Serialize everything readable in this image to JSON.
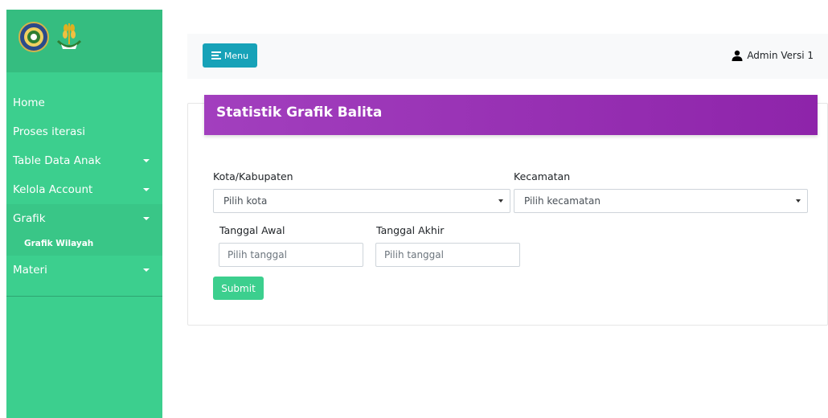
{
  "sidebar": {
    "logos": [
      "university-seal-logo",
      "wheat-emblem-logo"
    ],
    "items": [
      {
        "label": "Home",
        "has_caret": false
      },
      {
        "label": "Proses iterasi",
        "has_caret": false
      },
      {
        "label": "Table Data Anak",
        "has_caret": true
      },
      {
        "label": "Kelola Account",
        "has_caret": true
      },
      {
        "label": "Grafik",
        "has_caret": true,
        "expanded": true,
        "subitems": [
          {
            "label": "Grafik Wilayah"
          }
        ]
      },
      {
        "label": "Materi",
        "has_caret": true
      }
    ]
  },
  "topbar": {
    "menu_label": "Menu",
    "menu_icon": "hamburger-icon",
    "user_icon": "user-icon",
    "user_label": "Admin Versi 1"
  },
  "card": {
    "title": "Statistik Grafik Balita",
    "form": {
      "kota_label": "Kota/Kabupaten",
      "kota_value": "Pilih kota",
      "kecamatan_label": "Kecamatan",
      "kecamatan_value": "Pilih kecamatan",
      "tanggal_awal_label": "Tanggal Awal",
      "tanggal_awal_placeholder": "Pilih tanggal",
      "tanggal_akhir_label": "Tanggal Akhir",
      "tanggal_akhir_placeholder": "Pilih tanggal",
      "submit_label": "Submit"
    }
  },
  "colors": {
    "sidebar": "#3ccf8e",
    "menu_button": "#17a2b8",
    "header_gradient_start": "#a23fbe",
    "header_gradient_end": "#8e24aa",
    "submit_button": "#3ccf8e"
  }
}
